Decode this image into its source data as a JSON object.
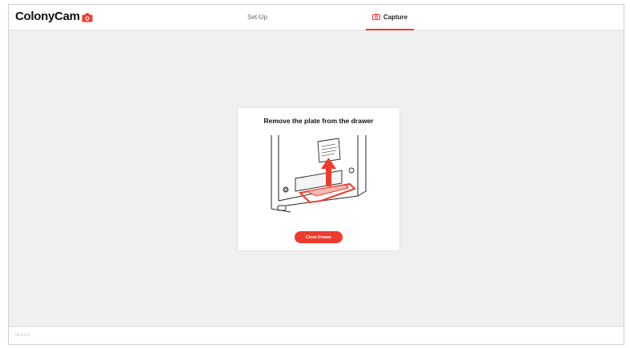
{
  "app": {
    "name": "ColonyCam"
  },
  "nav": {
    "tabs": [
      {
        "label": "Set-Up",
        "active": false
      },
      {
        "label": "Capture",
        "active": true
      }
    ]
  },
  "dialog": {
    "title": "Remove the plate from the drawer",
    "button_label": "Close Drawer",
    "illustration_label": "colony plate"
  },
  "footer": {
    "version": "v2.0.1.1"
  },
  "colors": {
    "accent": "#ef3b2d",
    "background": "#efefef",
    "surface": "#ffffff"
  },
  "icons": [
    "camera-icon",
    "arrow-up-icon"
  ]
}
